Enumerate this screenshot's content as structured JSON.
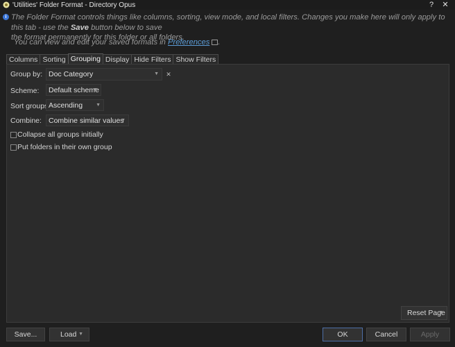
{
  "window": {
    "title": "'Utilities' Folder Format - Directory Opus",
    "help_label": "?",
    "close_label": "✕"
  },
  "info": {
    "line1": "The Folder Format controls things like columns, sorting, view mode, and local filters. Changes you make here will only apply to this tab - use the ",
    "save_word": "Save",
    "line1_end": " button below to save",
    "line2": "the format permanently for this folder or all folders.",
    "pref_prefix": "You can view and edit your saved formats in ",
    "pref_link": "Preferences"
  },
  "tabs": [
    {
      "label": "Columns"
    },
    {
      "label": "Sorting"
    },
    {
      "label": "Grouping"
    },
    {
      "label": "Display"
    },
    {
      "label": "Hide Filters"
    },
    {
      "label": "Show Filters"
    }
  ],
  "grouping": {
    "group_by_label": "Group by:",
    "group_by_value": "Doc Category",
    "scheme_label": "Scheme:",
    "scheme_value": "Default scheme",
    "sort_groups_label": "Sort groups:",
    "sort_groups_value": "Ascending",
    "combine_label": "Combine:",
    "combine_value": "Combine similar values",
    "collapse_label": "Collapse all groups initially",
    "collapse_checked": false,
    "folders_label": "Put folders in their own group",
    "folders_checked": false
  },
  "buttons": {
    "reset_page": "Reset Page",
    "save": "Save...",
    "load": "Load",
    "ok": "OK",
    "cancel": "Cancel",
    "apply": "Apply"
  }
}
